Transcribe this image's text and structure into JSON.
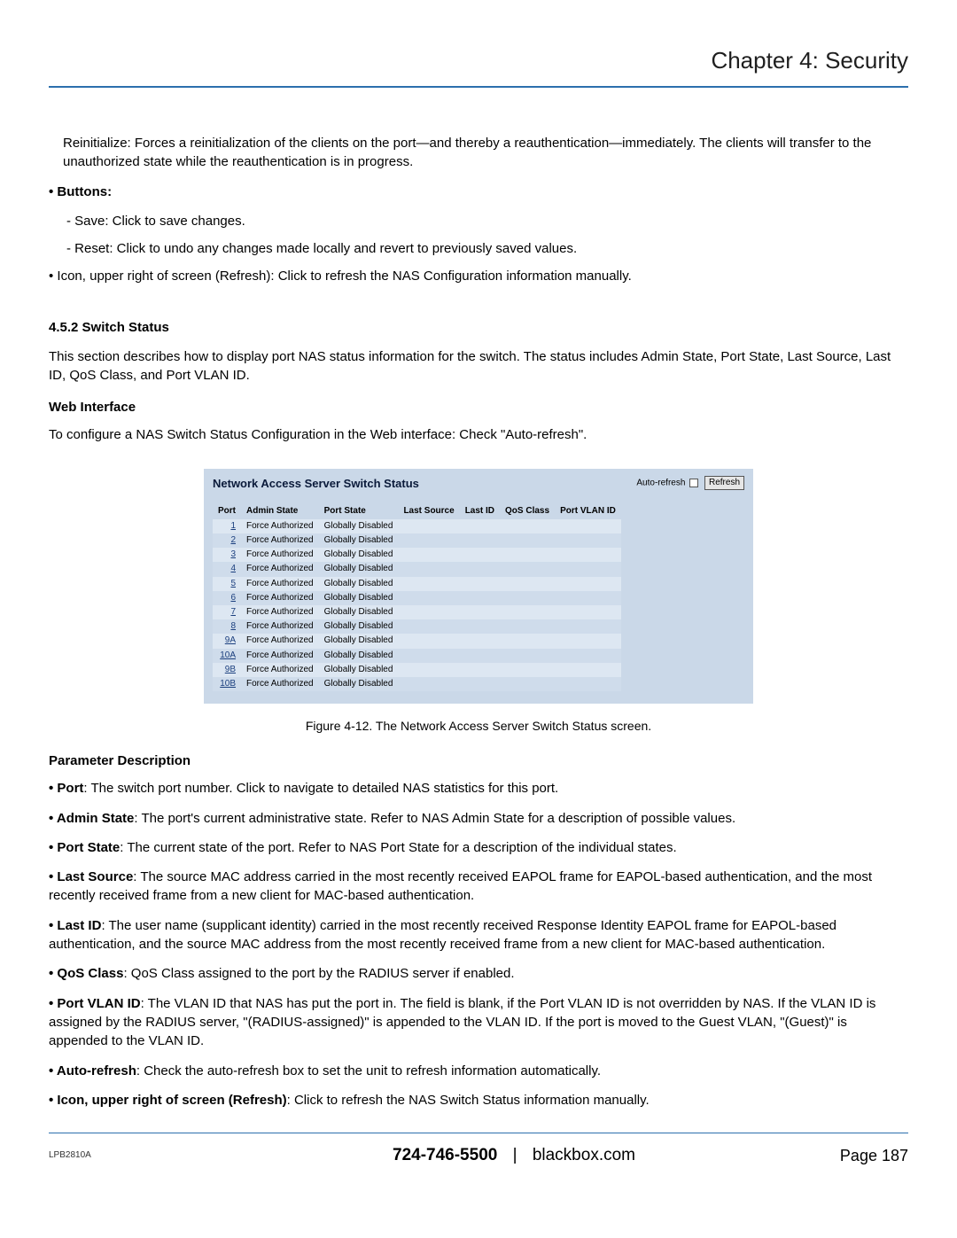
{
  "header": {
    "title": "Chapter 4: Security"
  },
  "intro": {
    "reinit": "Reinitialize: Forces a reinitialization of the clients on the port—and thereby a reauthentication—immediately. The clients will transfer to the unauthorized state while the reauthentication is in progress.",
    "buttons_label": "• Buttons:",
    "save": "- Save: Click to save changes.",
    "reset": "- Reset: Click to undo any changes made locally and revert to previously saved values.",
    "icon_refresh": "• Icon, upper right of screen (Refresh): Click to refresh the NAS Configuration information manually."
  },
  "section": {
    "num_title": "4.5.2 Switch Status",
    "desc": "This section describes how to display port NAS status information for the switch. The status includes Admin State, Port State, Last Source, Last ID, QoS Class, and Port VLAN ID.",
    "web_hdr": "Web Interface",
    "web_desc": "To configure a NAS Switch Status Configuration in the Web interface: Check \"Auto-refresh\"."
  },
  "figure": {
    "title": "Network Access Server Switch Status",
    "auto_refresh_label": "Auto-refresh",
    "refresh_btn": "Refresh",
    "columns": [
      "Port",
      "Admin State",
      "Port State",
      "Last Source",
      "Last ID",
      "QoS Class",
      "Port VLAN ID"
    ],
    "rows": [
      {
        "port": "1",
        "admin": "Force Authorized",
        "pstate": "Globally Disabled"
      },
      {
        "port": "2",
        "admin": "Force Authorized",
        "pstate": "Globally Disabled"
      },
      {
        "port": "3",
        "admin": "Force Authorized",
        "pstate": "Globally Disabled"
      },
      {
        "port": "4",
        "admin": "Force Authorized",
        "pstate": "Globally Disabled"
      },
      {
        "port": "5",
        "admin": "Force Authorized",
        "pstate": "Globally Disabled"
      },
      {
        "port": "6",
        "admin": "Force Authorized",
        "pstate": "Globally Disabled"
      },
      {
        "port": "7",
        "admin": "Force Authorized",
        "pstate": "Globally Disabled"
      },
      {
        "port": "8",
        "admin": "Force Authorized",
        "pstate": "Globally Disabled"
      },
      {
        "port": "9A",
        "admin": "Force Authorized",
        "pstate": "Globally Disabled"
      },
      {
        "port": "10A",
        "admin": "Force Authorized",
        "pstate": "Globally Disabled"
      },
      {
        "port": "9B",
        "admin": "Force Authorized",
        "pstate": "Globally Disabled"
      },
      {
        "port": "10B",
        "admin": "Force Authorized",
        "pstate": "Globally Disabled"
      }
    ],
    "caption": "Figure 4-12. The Network Access Server Switch Status screen."
  },
  "params": {
    "header": "Parameter Description",
    "items": [
      {
        "k": "• Port",
        "v": ": The switch port number. Click to navigate to detailed NAS statistics for this port."
      },
      {
        "k": "• Admin State",
        "v": ": The port's current administrative state. Refer to NAS Admin State for a description of possible values."
      },
      {
        "k": "• Port State",
        "v": ": The current state of the port. Refer to NAS Port State for a description of the individual states."
      },
      {
        "k": "• Last Source",
        "v": ": The source MAC address carried in the most recently received EAPOL frame for EAPOL-based authentication, and the most recently received frame from a new client for MAC-based authentication."
      },
      {
        "k": "• Last ID",
        "v": ": The user name (supplicant identity) carried in the most recently received Response Identity EAPOL frame for EAPOL-based authentication, and the source MAC address from the most recently received frame from a new client for MAC-based authentication."
      },
      {
        "k": "• QoS Class",
        "v": ": QoS Class assigned to the port by the RADIUS server if enabled."
      },
      {
        "k": "• Port VLAN ID",
        "v": ": The VLAN ID that NAS has put the port in.           The field is blank, if the Port VLAN ID is not overridden by NAS. If the VLAN ID is assigned by the RADIUS server, \"(RADIUS-assigned)\" is appended to the VLAN ID.  If the port is moved to the Guest VLAN, \"(Guest)\" is appended to the VLAN ID."
      },
      {
        "k": "• Auto-refresh",
        "v": ": Check the auto-refresh box to set the unit to refresh information automatically."
      },
      {
        "k": "• Icon, upper right of screen (Refresh)",
        "v": ": Click to refresh the NAS Switch Status information manually."
      }
    ]
  },
  "footer": {
    "model": "LPB2810A",
    "phone": "724-746-5500",
    "site": "blackbox.com",
    "page": "Page 187"
  }
}
